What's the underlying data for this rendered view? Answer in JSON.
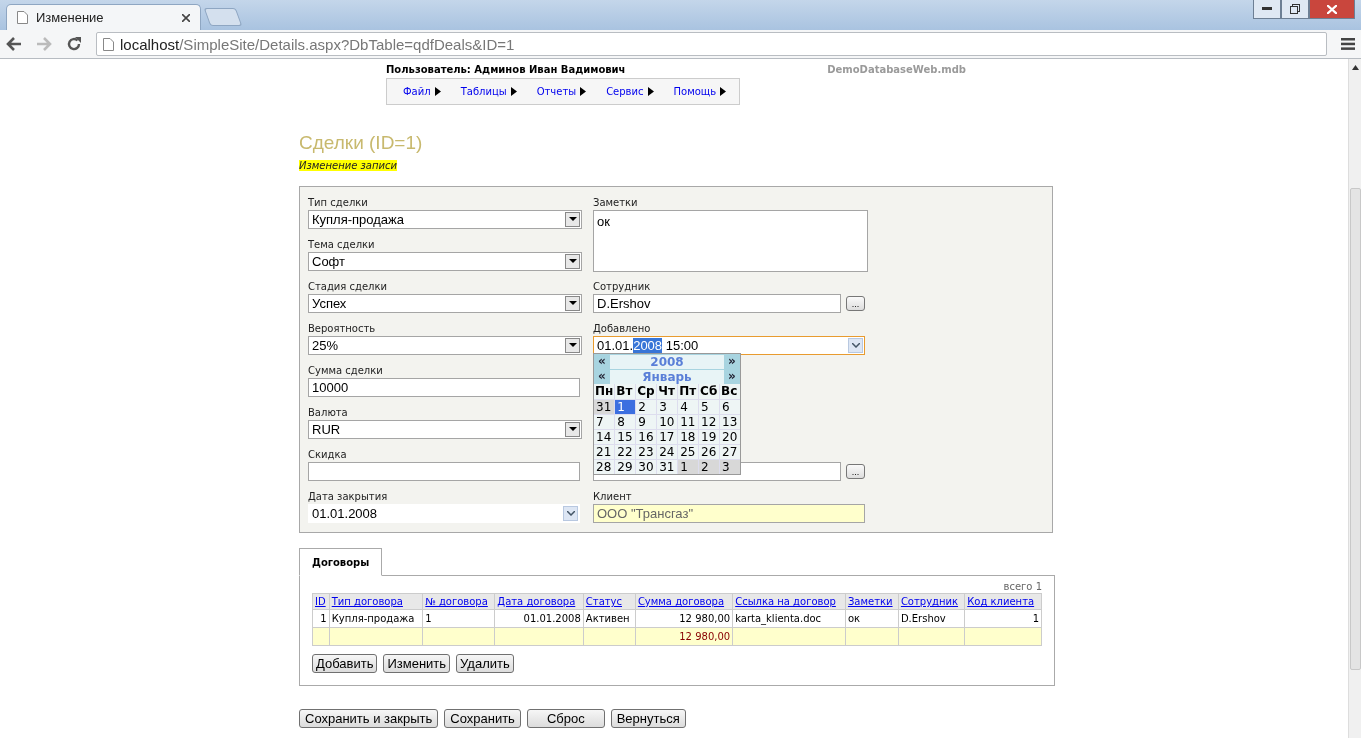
{
  "browser": {
    "tab_title": "Изменение",
    "url_host": "localhost",
    "url_path": "/SimpleSite/Details.aspx?DbTable=qdfDeals&ID=1"
  },
  "header": {
    "user": "Пользователь: Админов Иван Вадимович",
    "database": "DemoDatabaseWeb.mdb"
  },
  "menu": [
    {
      "label": "Файл"
    },
    {
      "label": "Таблицы"
    },
    {
      "label": "Отчеты"
    },
    {
      "label": "Сервис"
    },
    {
      "label": "Помощь"
    }
  ],
  "page": {
    "title": "Сделки (ID=1)",
    "subtitle": "Изменение записи"
  },
  "left_fields": [
    {
      "kind": "select",
      "label": "Тип сделки",
      "value": "Купля-продажа"
    },
    {
      "kind": "select",
      "label": "Тема сделки",
      "value": "Софт"
    },
    {
      "kind": "select",
      "label": "Стадия сделки",
      "value": "Успех"
    },
    {
      "kind": "select",
      "label": "Вероятность",
      "value": "25%"
    },
    {
      "kind": "text",
      "label": "Сумма сделки",
      "value": "10000"
    },
    {
      "kind": "select",
      "label": "Валюта",
      "value": "RUR"
    },
    {
      "kind": "text",
      "label": "Скидка"
    },
    {
      "kind": "date",
      "label": "Дата закрытия",
      "value": "01.01.2008"
    }
  ],
  "right_fields": [
    {
      "kind": "textarea",
      "label": "Заметки",
      "value": "ок"
    },
    {
      "kind": "lookup",
      "label": "Сотрудник",
      "value": "D.Ershov",
      "button": "..."
    },
    {
      "kind": "datetime",
      "label": "Добавлено",
      "value_before": "01.01.",
      "value_selected": "2008",
      "value_after": " 15:00"
    },
    {
      "kind": "lookup",
      "button": "..."
    },
    {
      "kind": "readonly",
      "label": "Клиент",
      "value": "ООО \"Трансгаз\""
    }
  ],
  "calendar": {
    "prev_year": "«",
    "year": "2008",
    "next_year": "»",
    "prev_month": "«",
    "month": "Январь",
    "next_month": "»",
    "weekdays": [
      "Пн",
      "Вт",
      "Ср",
      "Чт",
      "Пт",
      "Сб",
      "Вс"
    ],
    "weeks": [
      [
        {
          "day": "31",
          "other_month": true,
          "selected": false
        },
        {
          "day": "1",
          "other_month": false,
          "selected": true
        },
        {
          "day": "2",
          "other_month": false,
          "selected": false
        },
        {
          "day": "3",
          "other_month": false,
          "selected": false
        },
        {
          "day": "4",
          "other_month": false,
          "selected": false
        },
        {
          "day": "5",
          "other_month": false,
          "selected": false
        },
        {
          "day": "6",
          "other_month": false,
          "selected": false
        }
      ],
      [
        {
          "day": "7",
          "other_month": false,
          "selected": false
        },
        {
          "day": "8",
          "other_month": false,
          "selected": false
        },
        {
          "day": "9",
          "other_month": false,
          "selected": false
        },
        {
          "day": "10",
          "other_month": false,
          "selected": false
        },
        {
          "day": "11",
          "other_month": false,
          "selected": false
        },
        {
          "day": "12",
          "other_month": false,
          "selected": false
        },
        {
          "day": "13",
          "other_month": false,
          "selected": false
        }
      ],
      [
        {
          "day": "14",
          "other_month": false,
          "selected": false
        },
        {
          "day": "15",
          "other_month": false,
          "selected": false
        },
        {
          "day": "16",
          "other_month": false,
          "selected": false
        },
        {
          "day": "17",
          "other_month": false,
          "selected": false
        },
        {
          "day": "18",
          "other_month": false,
          "selected": false
        },
        {
          "day": "19",
          "other_month": false,
          "selected": false
        },
        {
          "day": "20",
          "other_month": false,
          "selected": false
        }
      ],
      [
        {
          "day": "21",
          "other_month": false,
          "selected": false
        },
        {
          "day": "22",
          "other_month": false,
          "selected": false
        },
        {
          "day": "23",
          "other_month": false,
          "selected": false
        },
        {
          "day": "24",
          "other_month": false,
          "selected": false
        },
        {
          "day": "25",
          "other_month": false,
          "selected": false
        },
        {
          "day": "26",
          "other_month": false,
          "selected": false
        },
        {
          "day": "27",
          "other_month": false,
          "selected": false
        }
      ],
      [
        {
          "day": "28",
          "other_month": false,
          "selected": false
        },
        {
          "day": "29",
          "other_month": false,
          "selected": false
        },
        {
          "day": "30",
          "other_month": false,
          "selected": false
        },
        {
          "day": "31",
          "other_month": false,
          "selected": false
        },
        {
          "day": "1",
          "other_month": true,
          "selected": false
        },
        {
          "day": "2",
          "other_month": true,
          "selected": false
        },
        {
          "day": "3",
          "other_month": true,
          "selected": false
        }
      ]
    ]
  },
  "tabs": [
    {
      "label": "Договоры",
      "selected": true
    }
  ],
  "table": {
    "total": "всего 1",
    "columns": [
      {
        "label": "ID",
        "kind": "number"
      },
      {
        "label": "Тип договора",
        "kind": "text"
      },
      {
        "label": "№ договора",
        "kind": "text"
      },
      {
        "label": "Дата договора",
        "kind": "number"
      },
      {
        "label": "Статус",
        "kind": "text"
      },
      {
        "label": "Сумма договора",
        "kind": "number",
        "total": "12 980,00"
      },
      {
        "label": "Ссылка на договор",
        "kind": "text"
      },
      {
        "label": "Заметки",
        "kind": "text"
      },
      {
        "label": "Сотрудник",
        "kind": "text"
      },
      {
        "label": "Код клиента",
        "kind": "number"
      }
    ],
    "rows": [
      [
        "1",
        "Купля-продажа",
        "1",
        "01.01.2008",
        "Активен",
        "12 980,00",
        "karta_klienta.doc",
        "ок",
        "D.Ershov",
        "1"
      ]
    ]
  },
  "table_buttons": [
    "Добавить",
    "Изменить",
    "Удалить"
  ],
  "buttons": [
    "Сохранить и закрыть",
    "Сохранить",
    "Сброс",
    "Вернуться"
  ]
}
